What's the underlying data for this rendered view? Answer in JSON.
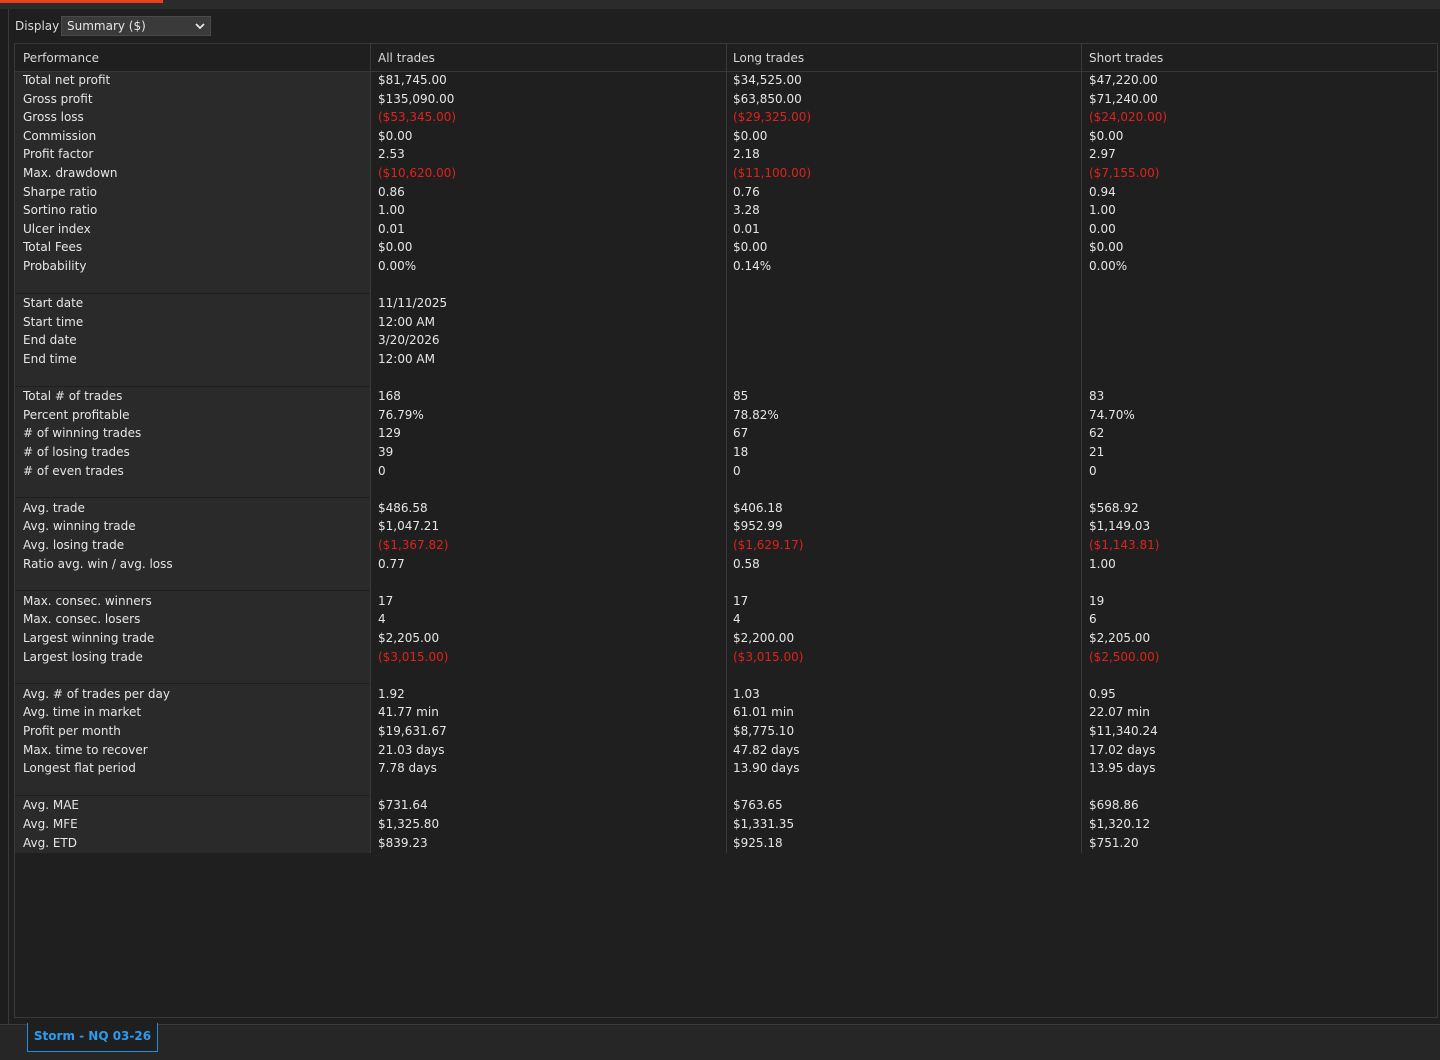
{
  "display": {
    "label": "Display",
    "value": "Summary ($)"
  },
  "headers": [
    "Performance",
    "All trades",
    "Long trades",
    "Short trades"
  ],
  "rows": [
    {
      "label": "Total net profit",
      "all": "$81,745.00",
      "long": "$34,525.00",
      "short": "$47,220.00"
    },
    {
      "label": "Gross profit",
      "all": "$135,090.00",
      "long": "$63,850.00",
      "short": "$71,240.00"
    },
    {
      "label": "Gross loss",
      "all": "($53,345.00)",
      "long": "($29,325.00)",
      "short": "($24,020.00)",
      "neg": true
    },
    {
      "label": "Commission",
      "all": "$0.00",
      "long": "$0.00",
      "short": "$0.00"
    },
    {
      "label": "Profit factor",
      "all": "2.53",
      "long": "2.18",
      "short": "2.97"
    },
    {
      "label": "Max. drawdown",
      "all": "($10,620.00)",
      "long": "($11,100.00)",
      "short": "($7,155.00)",
      "neg": true
    },
    {
      "label": "Sharpe ratio",
      "all": "0.86",
      "long": "0.76",
      "short": "0.94"
    },
    {
      "label": "Sortino ratio",
      "all": "1.00",
      "long": "3.28",
      "short": "1.00"
    },
    {
      "label": "Ulcer index",
      "all": "0.01",
      "long": "0.01",
      "short": "0.00"
    },
    {
      "label": "Total Fees",
      "all": "$0.00",
      "long": "$0.00",
      "short": "$0.00"
    },
    {
      "label": "Probability",
      "all": "0.00%",
      "long": "0.14%",
      "short": "0.00%"
    },
    {
      "blank": true
    },
    {
      "label": "Start date",
      "all": "11/11/2025",
      "long": "",
      "short": ""
    },
    {
      "label": "Start time",
      "all": "12:00 AM",
      "long": "",
      "short": ""
    },
    {
      "label": "End date",
      "all": "3/20/2026",
      "long": "",
      "short": ""
    },
    {
      "label": "End time",
      "all": "12:00 AM",
      "long": "",
      "short": ""
    },
    {
      "blank": true
    },
    {
      "label": "Total # of trades",
      "all": "168",
      "long": "85",
      "short": "83"
    },
    {
      "label": "Percent profitable",
      "all": "76.79%",
      "long": "78.82%",
      "short": "74.70%"
    },
    {
      "label": "# of winning trades",
      "all": "129",
      "long": "67",
      "short": "62"
    },
    {
      "label": "# of losing trades",
      "all": "39",
      "long": "18",
      "short": "21"
    },
    {
      "label": "# of even trades",
      "all": "0",
      "long": "0",
      "short": "0"
    },
    {
      "blank": true
    },
    {
      "label": "Avg. trade",
      "all": "$486.58",
      "long": "$406.18",
      "short": "$568.92"
    },
    {
      "label": "Avg. winning trade",
      "all": "$1,047.21",
      "long": "$952.99",
      "short": "$1,149.03"
    },
    {
      "label": "Avg. losing trade",
      "all": "($1,367.82)",
      "long": "($1,629.17)",
      "short": "($1,143.81)",
      "neg": true
    },
    {
      "label": "Ratio avg. win / avg. loss",
      "all": "0.77",
      "long": "0.58",
      "short": "1.00"
    },
    {
      "blank": true
    },
    {
      "label": "Max. consec. winners",
      "all": "17",
      "long": "17",
      "short": "19"
    },
    {
      "label": "Max. consec. losers",
      "all": "4",
      "long": "4",
      "short": "6"
    },
    {
      "label": "Largest winning trade",
      "all": "$2,205.00",
      "long": "$2,200.00",
      "short": "$2,205.00"
    },
    {
      "label": "Largest losing trade",
      "all": "($3,015.00)",
      "long": "($3,015.00)",
      "short": "($2,500.00)",
      "neg": true
    },
    {
      "blank": true
    },
    {
      "label": "Avg. # of trades per day",
      "all": "1.92",
      "long": "1.03",
      "short": "0.95"
    },
    {
      "label": "Avg. time in market",
      "all": "41.77 min",
      "long": "61.01 min",
      "short": "22.07 min"
    },
    {
      "label": "Profit per month",
      "all": "$19,631.67",
      "long": "$8,775.10",
      "short": "$11,340.24"
    },
    {
      "label": "Max. time to recover",
      "all": "21.03 days",
      "long": "47.82 days",
      "short": "17.02 days"
    },
    {
      "label": "Longest flat period",
      "all": "7.78 days",
      "long": "13.90 days",
      "short": "13.95 days"
    },
    {
      "blank": true
    },
    {
      "label": "Avg. MAE",
      "all": "$731.64",
      "long": "$763.65",
      "short": "$698.86"
    },
    {
      "label": "Avg. MFE",
      "all": "$1,325.80",
      "long": "$1,331.35",
      "short": "$1,320.12"
    },
    {
      "label": "Avg. ETD",
      "all": "$839.23",
      "long": "$925.18",
      "short": "$751.20"
    }
  ],
  "bottom_tab": "Storm - NQ 03-26",
  "colors": {
    "accent": "#e6411b",
    "negative": "#e0221c",
    "tab": "#2c9cf0"
  }
}
